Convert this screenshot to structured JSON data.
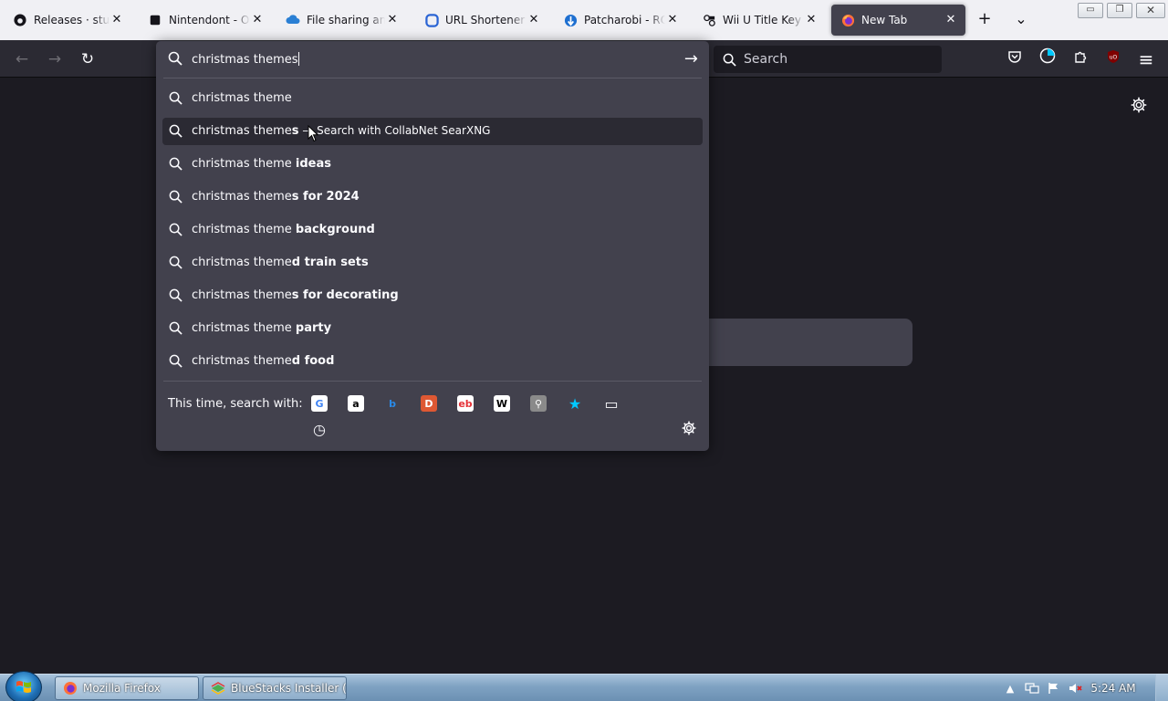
{
  "tabs": [
    {
      "title": "Releases · stuff-by",
      "favicon": "github-icon",
      "active": false
    },
    {
      "title": "Nintendont - Ope",
      "favicon": "nintendont-icon",
      "active": false
    },
    {
      "title": "File sharing and st",
      "favicon": "file-sharing-icon",
      "active": false
    },
    {
      "title": "URL Shortener",
      "favicon": "url-shortener-icon",
      "active": false
    },
    {
      "title": "Patcharobi - ROM",
      "favicon": "patcharobi-icon",
      "active": false
    },
    {
      "title": "Wii U Title Key Da",
      "favicon": "wiiu-icon",
      "active": false
    },
    {
      "title": "New Tab",
      "favicon": "firefox-icon",
      "active": true
    }
  ],
  "tabstrip": {
    "new_tab_symbol": "+",
    "list_all_tabs_symbol": "⌄",
    "close_symbol": "✕"
  },
  "window_controls": {
    "minimize": "▭",
    "restore": "❐",
    "close": "✕"
  },
  "navbar": {
    "back_symbol": "←",
    "forward_symbol": "→",
    "reload_symbol": "↻",
    "search_placeholder": "Search",
    "menu_symbol": "≡"
  },
  "urlbar": {
    "value": "christmas themes",
    "go_symbol": "→",
    "results": [
      {
        "prefix": "christmas theme",
        "bold": "",
        "action": "",
        "selected": false
      },
      {
        "prefix": "christmas theme",
        "bold": "s",
        "action": " — Search with CollabNet SearXNG",
        "selected": true
      },
      {
        "prefix": "christmas theme ",
        "bold": "ideas",
        "action": "",
        "selected": false
      },
      {
        "prefix": "christmas theme",
        "bold": "s for 2024",
        "action": "",
        "selected": false
      },
      {
        "prefix": "christmas theme ",
        "bold": "background",
        "action": "",
        "selected": false
      },
      {
        "prefix": "christmas theme",
        "bold": "d train sets",
        "action": "",
        "selected": false
      },
      {
        "prefix": "christmas theme",
        "bold": "s for decorating",
        "action": "",
        "selected": false
      },
      {
        "prefix": "christmas theme ",
        "bold": "party",
        "action": "",
        "selected": false
      },
      {
        "prefix": "christmas theme",
        "bold": "d food",
        "action": "",
        "selected": false
      }
    ],
    "oneoff_label": "This time, search with:",
    "engines": [
      {
        "name": "google-engine-icon",
        "glyph": "G",
        "color": "#4285f4",
        "bg": "#ffffff"
      },
      {
        "name": "amazon-engine-icon",
        "glyph": "a",
        "color": "#000000",
        "bg": "#ffffff"
      },
      {
        "name": "bing-engine-icon",
        "glyph": "b",
        "color": "#2a8ae8",
        "bg": "transparent"
      },
      {
        "name": "duckduckgo-engine-icon",
        "glyph": "D",
        "color": "#ffffff",
        "bg": "#de5833"
      },
      {
        "name": "ebay-engine-icon",
        "glyph": "eb",
        "color": "#e53238",
        "bg": "#ffffff"
      },
      {
        "name": "wikipedia-engine-icon",
        "glyph": "W",
        "color": "#000000",
        "bg": "#ffffff"
      },
      {
        "name": "searxng-engine-icon",
        "glyph": "⚲",
        "color": "#ffffff",
        "bg": "#8a8a8a"
      },
      {
        "name": "bookmarks-icon",
        "glyph": "★",
        "color": "#00c8ff",
        "bg": "transparent"
      },
      {
        "name": "tabs-icon",
        "glyph": "▭",
        "color": "#fbfbfe",
        "bg": "transparent"
      },
      {
        "name": "history-icon",
        "glyph": "◷",
        "color": "#fbfbfe",
        "bg": "transparent"
      }
    ]
  },
  "taskbar": {
    "items": [
      {
        "label": "Mozilla Firefox",
        "icon": "firefox-icon",
        "active": true
      },
      {
        "label": "BlueStacks Installer (...",
        "icon": "bluestacks-icon",
        "active": false
      }
    ],
    "clock": "5:24 AM"
  },
  "colors": {
    "accent": "#00c8ff",
    "page_bg": "#1c1b22",
    "toolbar_bg": "#2b2a33",
    "popup_bg": "#42414d",
    "ublock_red": "#800000"
  }
}
